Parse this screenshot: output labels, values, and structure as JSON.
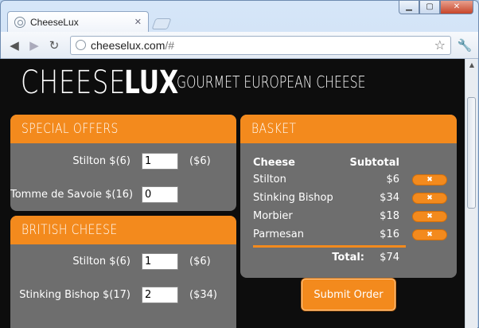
{
  "browser": {
    "tab_title": "CheeseLux",
    "tab_close": "✕",
    "url_host": "cheeselux.com",
    "url_path": "/#"
  },
  "header": {
    "logo_light": "CHEESE",
    "logo_bold": "LUX",
    "tagline": "GOURMET EUROPEAN CHEESE"
  },
  "special_offers": {
    "title": "SPECIAL OFFERS",
    "items": [
      {
        "label": "Stilton $(6)",
        "qty": "1",
        "subtotal": "($6)"
      },
      {
        "label": "Tomme de Savoie $(16)",
        "qty": "0",
        "subtotal": ""
      }
    ]
  },
  "british_cheese": {
    "title": "BRITISH CHEESE",
    "items": [
      {
        "label": "Stilton $(6)",
        "qty": "1",
        "subtotal": "($6)"
      },
      {
        "label": "Stinking Bishop $(17)",
        "qty": "2",
        "subtotal": "($34)"
      }
    ]
  },
  "basket": {
    "title": "BASKET",
    "col_cheese": "Cheese",
    "col_subtotal": "Subtotal",
    "remove_label": "✖",
    "rows": [
      {
        "name": "Stilton",
        "subtotal": "$6"
      },
      {
        "name": "Stinking Bishop",
        "subtotal": "$34"
      },
      {
        "name": "Morbier",
        "subtotal": "$18"
      },
      {
        "name": "Parmesan",
        "subtotal": "$16"
      }
    ],
    "total_label": "Total:",
    "total_value": "$74"
  },
  "submit_label": "Submit Order",
  "colors": {
    "accent": "#f38a1d",
    "panel": "#6e6e6e",
    "page_bg": "#0d0d0d"
  }
}
